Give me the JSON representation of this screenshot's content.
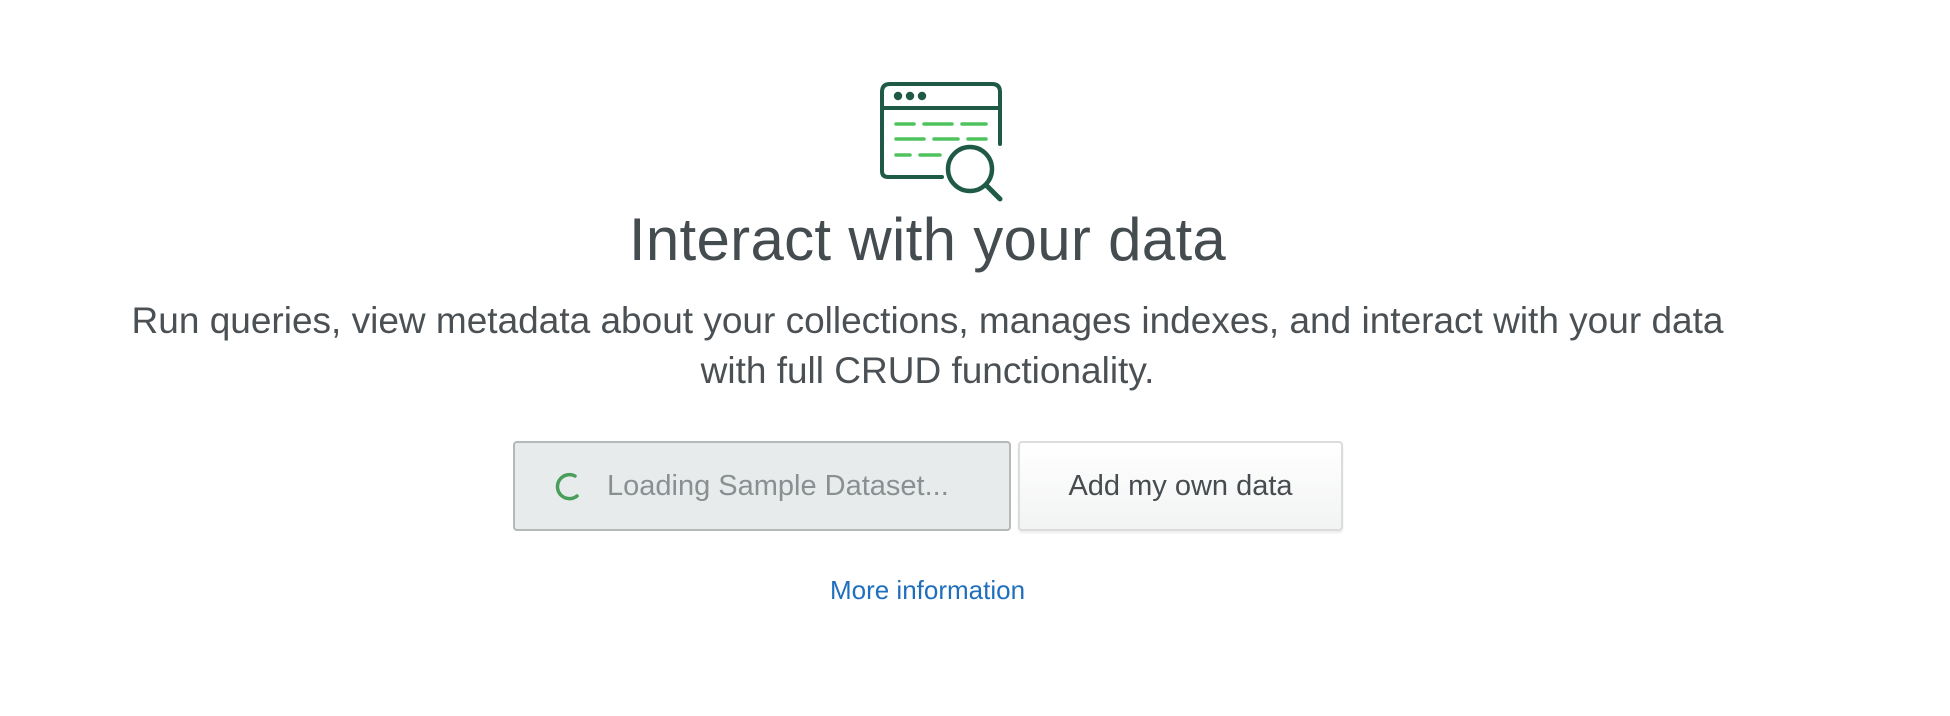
{
  "empty_state": {
    "illustration_icon": "browser-window-search-icon",
    "title": "Interact with your data",
    "description": "Run queries, view metadata about your collections, manages indexes, and interact with your data with full CRUD functionality.",
    "loading_button_label": "Loading Sample Dataset...",
    "loading_icon": "spinner-icon",
    "add_data_button_label": "Add my own data",
    "more_info_link": "More information"
  },
  "colors": {
    "icon_dark": "#1f5a46",
    "icon_accent": "#4fc35d",
    "link": "#1f6fbd",
    "spinner": "#4a9e5c"
  }
}
